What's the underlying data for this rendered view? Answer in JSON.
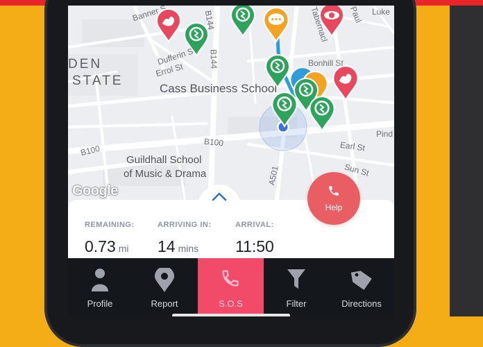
{
  "map": {
    "labels": {
      "banner_st": "Banner S",
      "b144_top": "B144",
      "b144_mid": "B144",
      "dufferin_st": "Dufferin St",
      "errol_st": "Errol St",
      "den": "DEN",
      "state": "STATE",
      "cass": "Cass Business School",
      "bonhill_st": "Bonhill St",
      "tabernacle": "Tabernacl",
      "paul": "Paul",
      "luke": "Luke",
      "pindar": "Pind",
      "earl_st": "Earl St",
      "sun_st": "Sun St",
      "b100_left": "B100",
      "b100_mid": "B100",
      "guildhall_1": "Guildhall School",
      "guildhall_2": "of Music & Drama",
      "a501": "A501"
    },
    "attribution": "Google",
    "colors": {
      "green_pin": "#2ea35c",
      "red_pin": "#e8485e",
      "orange_pin": "#f3a324",
      "blue_pin": "#2f9bd8"
    }
  },
  "help_button": {
    "label": "Help",
    "icon": "phone-icon"
  },
  "trip": {
    "remaining_label": "REMAINING:",
    "remaining_value": "0.73",
    "remaining_unit": "mi",
    "arriving_label": "ARRIVING IN:",
    "arriving_value": "14",
    "arriving_unit": "mins",
    "arrival_label": "ARRIVAL:",
    "arrival_value": "11:50"
  },
  "nav": {
    "profile": "Profile",
    "report": "Report",
    "sos": "S.O.S",
    "filter": "Filter",
    "directions": "Directions"
  }
}
